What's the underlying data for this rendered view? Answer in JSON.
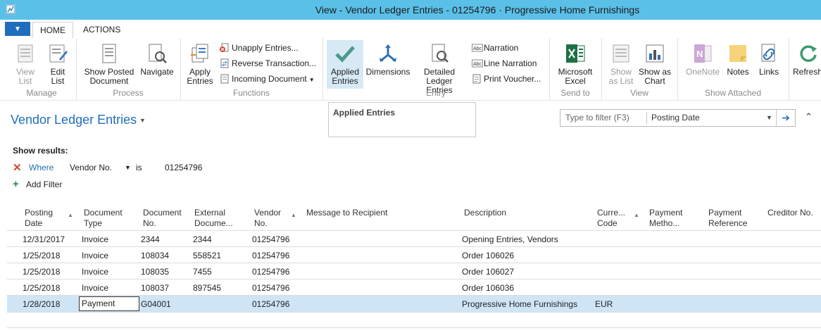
{
  "window": {
    "title": "View - Vendor Ledger Entries - 01254796 · Progressive Home Furnishings"
  },
  "tabs": [
    "HOME",
    "ACTIONS"
  ],
  "ribbon": {
    "manage": {
      "label": "Manage",
      "view_list": "View\nList",
      "edit_list": "Edit\nList"
    },
    "process": {
      "label": "Process",
      "show_posted": "Show Posted\nDocument",
      "navigate": "Navigate"
    },
    "functions": {
      "label": "Functions",
      "apply_entries": "Apply\nEntries",
      "unapply": "Unapply Entries...",
      "reverse": "Reverse Transaction...",
      "incoming": "Incoming Document"
    },
    "entry": {
      "label": "Entry",
      "applied_entries": "Applied\nEntries",
      "dimensions": "Dimensions",
      "detailed": "Detailed\nLedger Entries",
      "narration": "Narration",
      "line_narration": "Line Narration",
      "print_voucher": "Print Voucher..."
    },
    "send_to": {
      "label": "Send to",
      "excel": "Microsoft\nExcel"
    },
    "view": {
      "label": "View",
      "show_as_list": "Show\nas List",
      "show_as_chart": "Show as\nChart"
    },
    "attached": {
      "label": "Show Attached",
      "onenote": "OneNote",
      "notes": "Notes",
      "links": "Links"
    },
    "refresh": "Refresh"
  },
  "tooltip": "Applied Entries",
  "page": {
    "title": "Vendor Ledger Entries",
    "filter_placeholder": "Type to filter (F3)",
    "filter_field": "Posting Date"
  },
  "filters": {
    "show_results": "Show results:",
    "where": "Where",
    "field": "Vendor No.",
    "op": "is",
    "value": "01254796",
    "add_filter": "Add Filter"
  },
  "columns": [
    "Posting\nDate",
    "Document\nType",
    "Document\nNo.",
    "External\nDocume...",
    "Vendor\nNo.",
    "Message to Recipient",
    "Description",
    "Curre...\nCode",
    "Payment\nMetho...",
    "Payment\nReference",
    "Creditor No."
  ],
  "rows": [
    {
      "date": "12/31/2017",
      "type": "Invoice",
      "doc_no": "2344",
      "ext": "2344",
      "vendor": "01254796",
      "desc": "Opening Entries, Vendors",
      "cur": ""
    },
    {
      "date": "1/25/2018",
      "type": "Invoice",
      "doc_no": "108034",
      "ext": "558521",
      "vendor": "01254796",
      "desc": "Order 106026",
      "cur": ""
    },
    {
      "date": "1/25/2018",
      "type": "Invoice",
      "doc_no": "108035",
      "ext": "7455",
      "vendor": "01254796",
      "desc": "Order 106027",
      "cur": ""
    },
    {
      "date": "1/25/2018",
      "type": "Invoice",
      "doc_no": "108037",
      "ext": "897545",
      "vendor": "01254796",
      "desc": "Order 106036",
      "cur": ""
    },
    {
      "date": "1/28/2018",
      "type": "Payment",
      "doc_no": "G04001",
      "ext": "",
      "vendor": "01254796",
      "desc": "Progressive Home Furnishings",
      "cur": "EUR"
    }
  ],
  "colors": {
    "titlebar": "#5bc0e8",
    "accent": "#1e6fb8",
    "selected_row": "#cfe5f6"
  }
}
